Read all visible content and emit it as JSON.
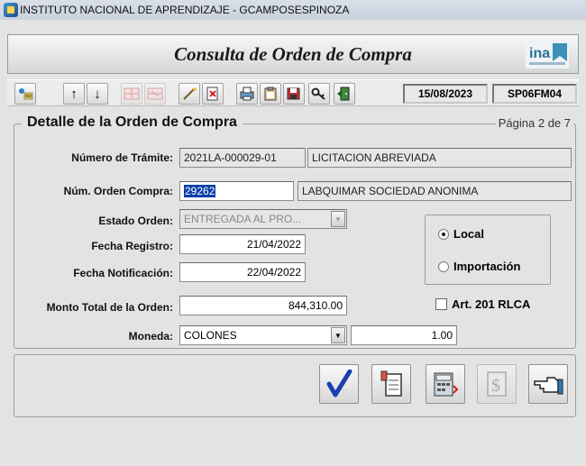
{
  "window": {
    "title": "INSTITUTO NACIONAL DE APRENDIZAJE - GCAMPOSESPINOZA"
  },
  "header": {
    "title": "Consulta de Orden de Compra",
    "logo_text": "ina"
  },
  "toolbar": {
    "date": "15/08/2023",
    "screen_code": "SP06FM04",
    "icons": [
      "query-icon",
      "arrow-up-icon",
      "arrow-down-icon",
      "insert-record-icon",
      "delete-record-icon",
      "clear-icon",
      "edit-icon",
      "print-icon",
      "clipboard-icon",
      "save-icon",
      "key-icon",
      "exit-door-icon"
    ]
  },
  "section": {
    "title": "Detalle de la Orden de Compra",
    "page_indicator": "Página 2 de 7"
  },
  "form": {
    "tramite": {
      "label": "Número de Trámite:",
      "value": "2021LA-000029-01",
      "type_text": "LICITACION ABREVIADA"
    },
    "orden": {
      "label": "Núm. Orden Compra:",
      "value": "29262",
      "supplier": "LABQUIMAR SOCIEDAD ANONIMA"
    },
    "estado": {
      "label": "Estado Orden:",
      "value": "ENTREGADA AL PRO..."
    },
    "fecha_registro": {
      "label": "Fecha Registro:",
      "value": "21/04/2022"
    },
    "fecha_notificacion": {
      "label": "Fecha Notificación:",
      "value": "22/04/2022"
    },
    "monto": {
      "label": "Monto Total de la Orden:",
      "value": "844,310.00"
    },
    "moneda": {
      "label": "Moneda:",
      "value": "COLONES",
      "rate": "1.00"
    },
    "origin": {
      "local": "Local",
      "importacion": "Importación",
      "selected": "Local"
    },
    "art201": {
      "label": "Art. 201 RLCA",
      "checked": false
    }
  },
  "actions": {
    "icons": [
      "accept-check-icon",
      "document-copy-icon",
      "calculator-transfer-icon",
      "money-icon",
      "pointing-hand-icon"
    ]
  },
  "colors": {
    "selection": "#0a3fa8",
    "background": "#e3e3e3",
    "checkmark": "#1a3fb0"
  }
}
